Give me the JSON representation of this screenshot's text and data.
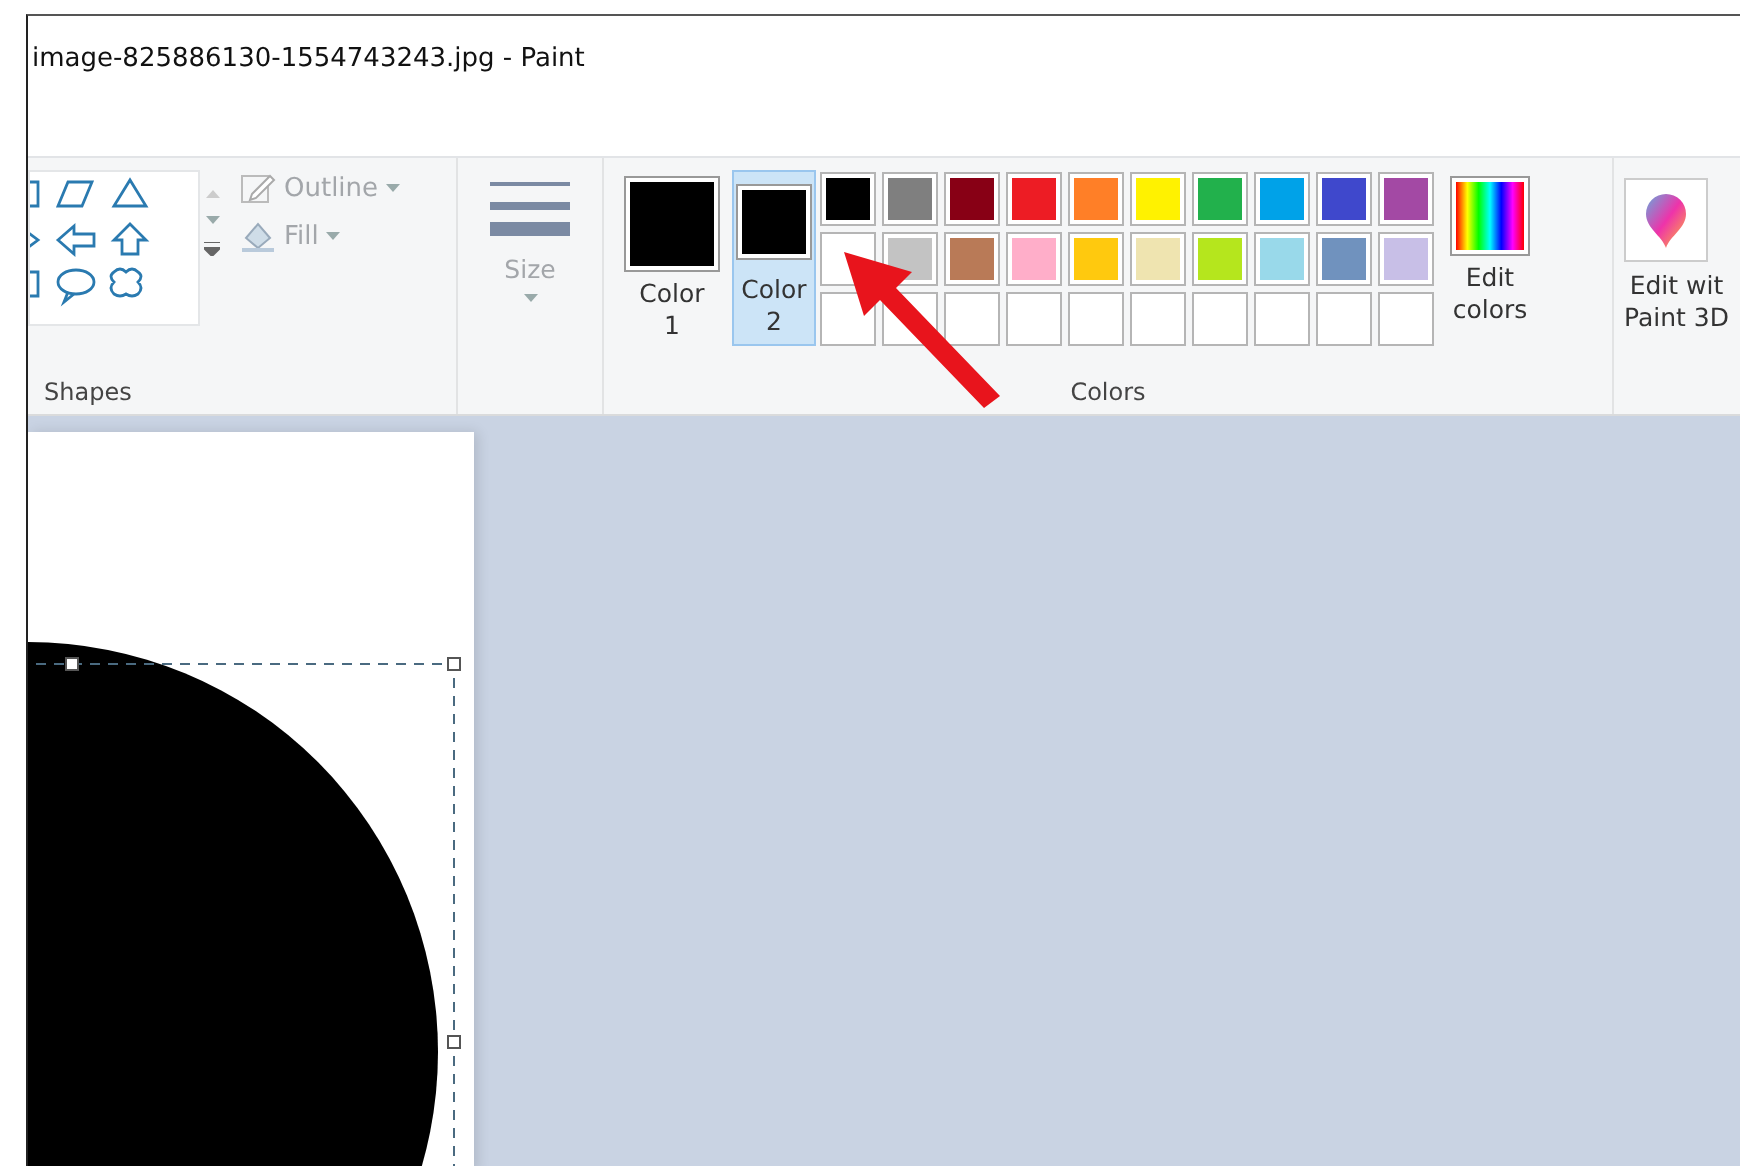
{
  "window": {
    "title": "image-825886130-1554743243.jpg - Paint"
  },
  "ribbon": {
    "shapes": {
      "label": "Shapes",
      "outline": {
        "label": "Outline",
        "disabled": true
      },
      "fill": {
        "label": "Fill",
        "disabled": true
      }
    },
    "size": {
      "label": "Size",
      "disabled": true
    },
    "colors": {
      "label": "Colors",
      "current": [
        {
          "label": "Color",
          "number": "1",
          "color": "#000000",
          "selected": false
        },
        {
          "label": "Color",
          "number": "2",
          "color": "#000000",
          "selected": true
        }
      ],
      "palette": [
        {
          "kind": "filled",
          "color": "#000000"
        },
        {
          "kind": "filled",
          "color": "#7f7f7f"
        },
        {
          "kind": "filled",
          "color": "#880015"
        },
        {
          "kind": "filled",
          "color": "#ed1c24"
        },
        {
          "kind": "filled",
          "color": "#ff7f27"
        },
        {
          "kind": "filled",
          "color": "#fff200"
        },
        {
          "kind": "filled",
          "color": "#22b14c"
        },
        {
          "kind": "filled",
          "color": "#00a2e8"
        },
        {
          "kind": "filled",
          "color": "#3f48cc"
        },
        {
          "kind": "filled",
          "color": "#a349a4"
        },
        {
          "kind": "filled",
          "color": "#ffffff"
        },
        {
          "kind": "filled",
          "color": "#c3c3c3"
        },
        {
          "kind": "filled",
          "color": "#b97a57"
        },
        {
          "kind": "filled",
          "color": "#ffaec9"
        },
        {
          "kind": "filled",
          "color": "#ffc90e"
        },
        {
          "kind": "filled",
          "color": "#efe4b0"
        },
        {
          "kind": "filled",
          "color": "#b5e61d"
        },
        {
          "kind": "filled",
          "color": "#99d9ea"
        },
        {
          "kind": "filled",
          "color": "#7092be"
        },
        {
          "kind": "filled",
          "color": "#c8bfe7"
        },
        {
          "kind": "empty"
        },
        {
          "kind": "empty"
        },
        {
          "kind": "empty"
        },
        {
          "kind": "empty"
        },
        {
          "kind": "empty"
        },
        {
          "kind": "empty"
        },
        {
          "kind": "empty"
        },
        {
          "kind": "empty"
        },
        {
          "kind": "empty"
        },
        {
          "kind": "empty"
        }
      ],
      "edit": {
        "lines": [
          "Edit",
          "colors"
        ]
      }
    },
    "paint3d": {
      "lines": [
        "Edit wit",
        "Paint 3D"
      ]
    }
  }
}
